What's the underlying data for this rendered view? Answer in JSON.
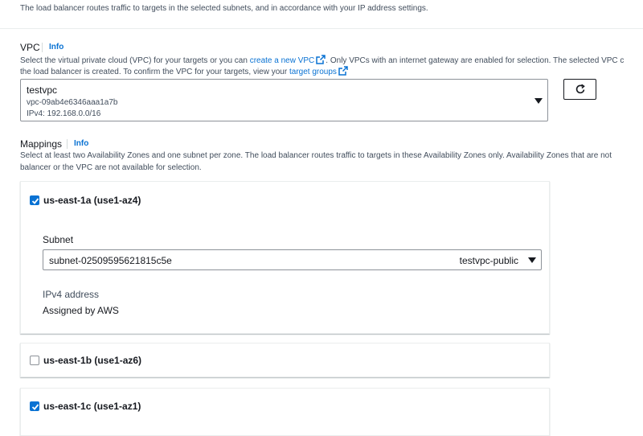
{
  "top": {
    "description": "The load balancer routes traffic to targets in the selected subnets, and in accordance with your IP address settings."
  },
  "vpc": {
    "label": "VPC",
    "info": "Info",
    "desc_part1": "Select the virtual private cloud (VPC) for your targets or you can ",
    "create_link": "create a new VPC",
    "desc_part2": ". Only VPCs with an internet gateway are enabled for selection. The selected VPC c",
    "desc_line2_part1": "the load balancer is created. To confirm the VPC for your targets, view your ",
    "target_groups_link": "target groups",
    "selected": {
      "name": "testvpc",
      "id": "vpc-09ab4e6346aaa1a7b",
      "cidr": "IPv4: 192.168.0.0/16"
    },
    "refresh_icon": "refresh-icon",
    "external_icon": "external-link-icon"
  },
  "mappings": {
    "label": "Mappings",
    "info": "Info",
    "desc_line1": "Select at least two Availability Zones and one subnet per zone. The load balancer routes traffic to targets in these Availability Zones only. Availability Zones that are not",
    "desc_line2": "balancer or the VPC are not available for selection.",
    "zones": [
      {
        "title": "us-east-1a (use1-az4)",
        "checked": true,
        "subnet_label": "Subnet",
        "subnet_id": "subnet-02509595621815c5e",
        "subnet_name": "testvpc-public",
        "ipv4_label": "IPv4 address",
        "ipv4_value": "Assigned by AWS"
      },
      {
        "title": "us-east-1b (use1-az6)",
        "checked": false
      },
      {
        "title": "us-east-1c (use1-az1)",
        "checked": true
      }
    ]
  },
  "colors": {
    "accent": "#0972d3",
    "text": "#16191f",
    "muted": "#414d5c",
    "border": "#8d9299"
  }
}
